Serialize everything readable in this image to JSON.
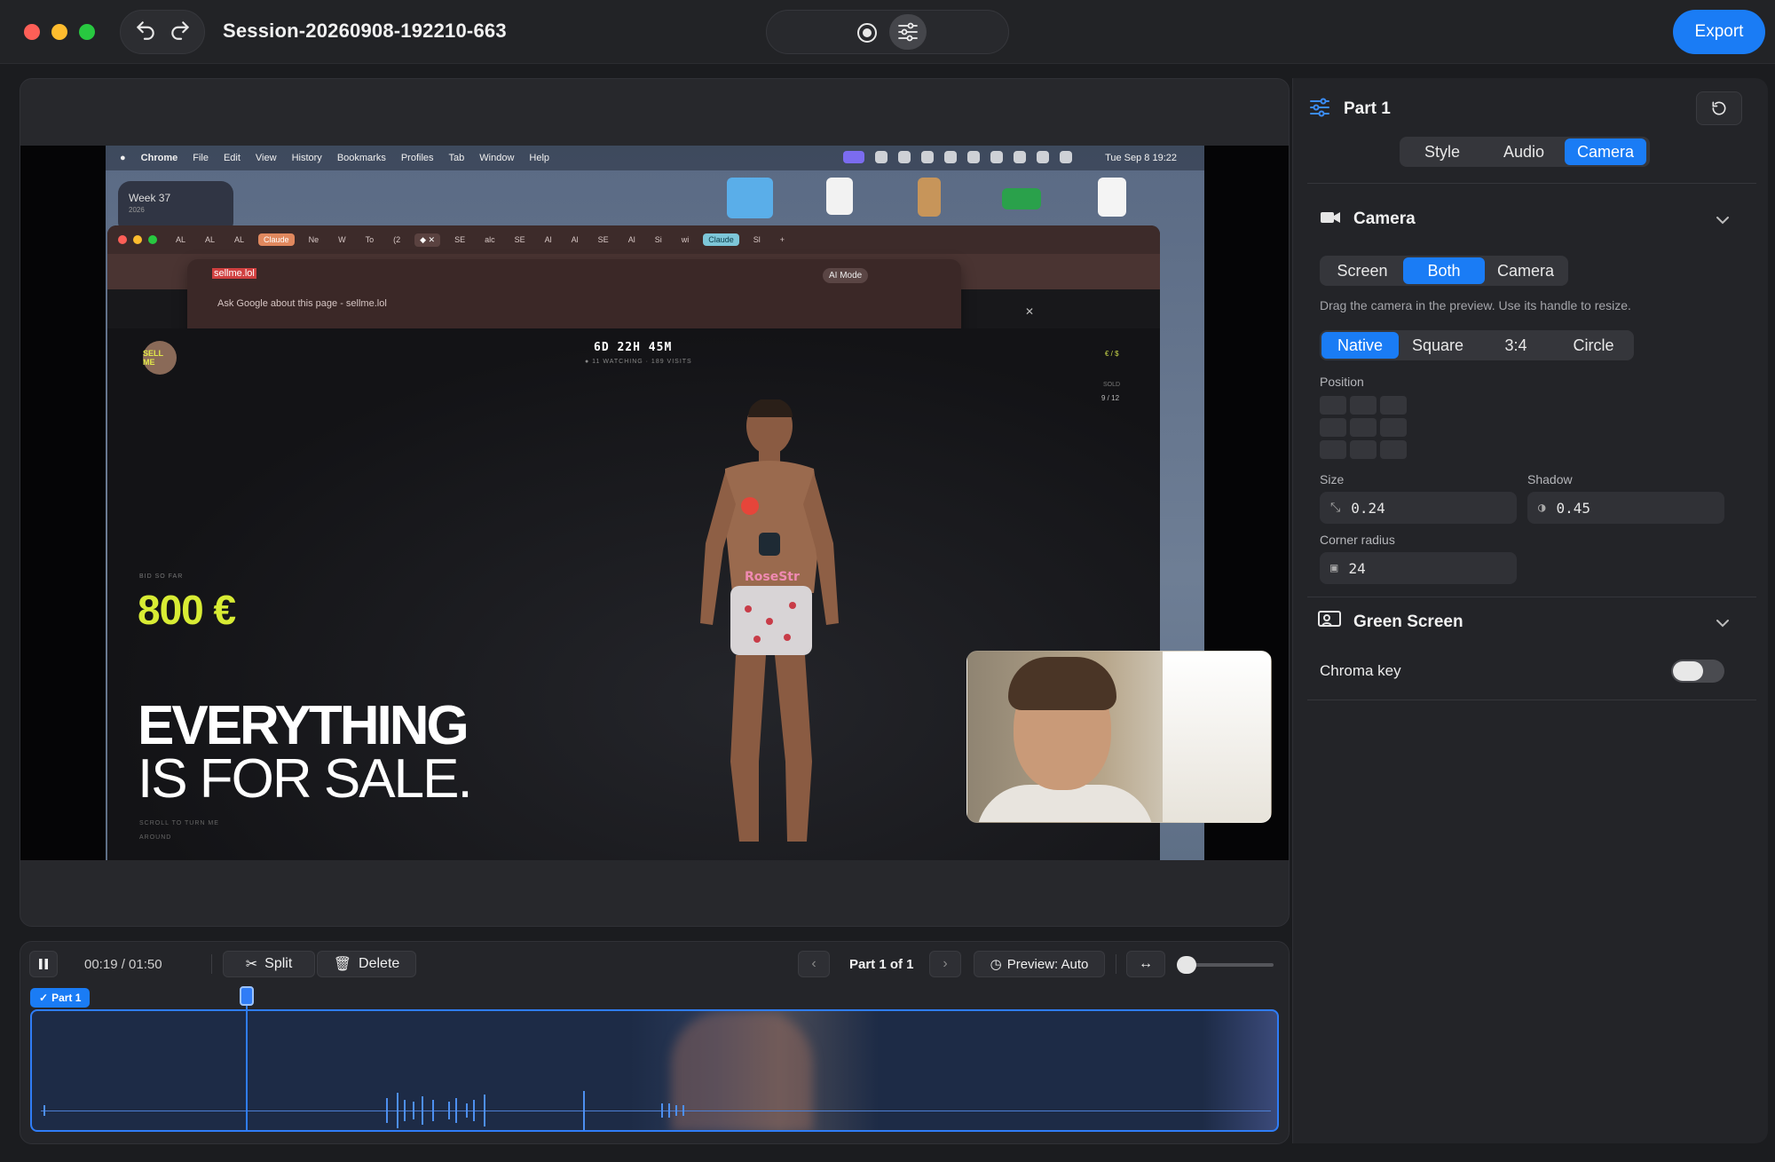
{
  "window": {
    "title": "Session-20260908-192210-663",
    "export_label": "Export",
    "undo_icon": "undo-icon",
    "redo_icon": "redo-icon"
  },
  "recording": {
    "mac_menubar": {
      "app": "Chrome",
      "menus": [
        "File",
        "Edit",
        "View",
        "History",
        "Bookmarks",
        "Profiles",
        "Tab",
        "Window",
        "Help"
      ],
      "clock": "Tue Sep 8  19:22"
    },
    "week_widget": {
      "title": "Week 37",
      "year": "2026"
    },
    "chrome_tabs": [
      "AL",
      "AL",
      "AL",
      "Claude",
      "Ne",
      "W",
      "To",
      "(2",
      "",
      "SE",
      "alc",
      "SE",
      "Al",
      "Al",
      "SE",
      "Al",
      "Si",
      "wi",
      "Claude",
      "Sl"
    ],
    "omnibox": {
      "url": "sellme.lol",
      "suggestion": "Ask Google about this page  -  sellme.lol",
      "ai_mode": "AI Mode"
    },
    "site": {
      "avatar_text": "SELL ME",
      "countdown": "6D 22H 45M",
      "countdown_sub": "● 11 WATCHING  ·  189 VISITS",
      "currency": "€ / $",
      "sold_label": "SOLD",
      "sold_value": "9 / 12",
      "bid_label": "BID SO FAR",
      "bid_value": "800 €",
      "headline_line1": "EVERYTHING",
      "headline_line2": "IS FOR SALE.",
      "scroll_hint": "SCROLL TO TURN ME AROUND"
    }
  },
  "timeline": {
    "time": "00:19 / 01:50",
    "progress_fraction": 0.173,
    "split_label": "Split",
    "delete_label": "Delete",
    "part_nav": "Part 1 of 1",
    "preview_label": "Preview: Auto",
    "clip_label": "Part 1"
  },
  "panel": {
    "title": "Part 1",
    "tabs": [
      "Style",
      "Audio",
      "Camera"
    ],
    "active_tab": "Camera",
    "camera_section": {
      "title": "Camera",
      "source_options": [
        "Screen",
        "Both",
        "Camera"
      ],
      "source_selected": "Both",
      "hint": "Drag the camera in the preview. Use its handle to resize.",
      "shape_options": [
        "Native",
        "Square",
        "3:4",
        "Circle"
      ],
      "shape_selected": "Native",
      "position_label": "Position",
      "size_label": "Size",
      "size_value": "0.24",
      "shadow_label": "Shadow",
      "shadow_value": "0.45",
      "corner_radius_label": "Corner radius",
      "corner_radius_value": "24"
    },
    "green_screen_section": {
      "title": "Green Screen",
      "chroma_key_label": "Chroma key",
      "chroma_key_on": false
    }
  },
  "colors": {
    "accent": "#1a7cf5",
    "bid": "#d8ec34",
    "background": "#1b1c1f"
  }
}
